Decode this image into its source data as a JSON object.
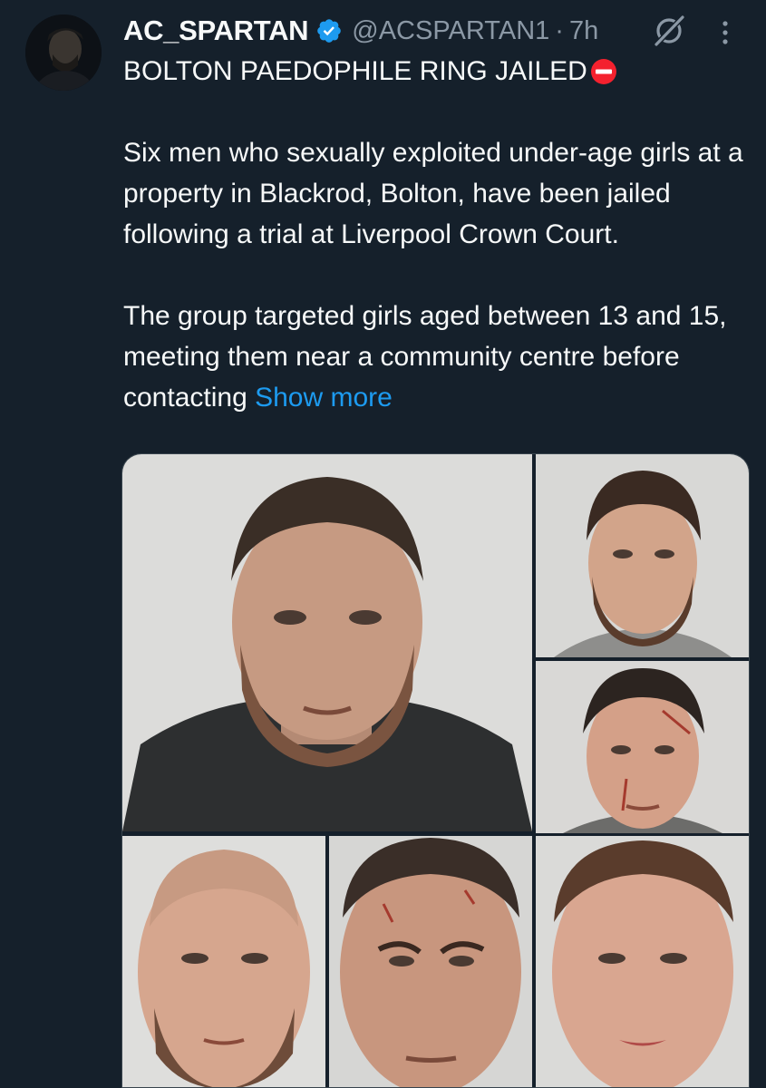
{
  "tweet": {
    "author": {
      "display_name": "AC_SPARTAN",
      "handle": "@ACSPARTAN1",
      "separator": "·",
      "time": "7h",
      "verified": true
    },
    "text": {
      "title": "BOLTON PAEDOPHILE RING JAILED",
      "title_emoji": "stop-sign-icon",
      "paragraph_1": "Six men who sexually exploited under-age girls at a property in Blackrod, Bolton, have been jailed following a trial at Liverpool Crown Court.",
      "paragraph_2": "The group targeted girls aged between 13 and 15, meeting them near a community centre before contacting",
      "show_more": "Show more"
    },
    "media": {
      "type": "photo-grid",
      "count": 6
    }
  },
  "colors": {
    "background": "#15202b",
    "text": "#f7f9f9",
    "secondary_text": "#8b98a5",
    "link": "#1d9bf0",
    "verified": "#1d9bf0",
    "stop_sign": "#f4212e"
  },
  "icons": {
    "verified": "verified-badge-icon",
    "grok": "grok-icon",
    "more": "more-options-icon"
  }
}
